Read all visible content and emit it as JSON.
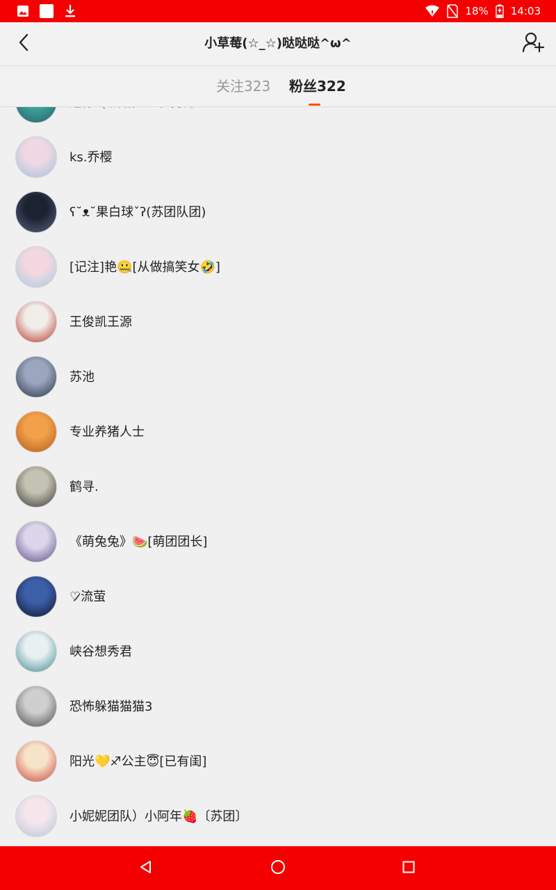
{
  "status_bar": {
    "battery": "18%",
    "time": "14:03",
    "icons": [
      "image-icon",
      "square-icon",
      "download-icon",
      "wifi-icon",
      "no-sim-icon",
      "battery-icon"
    ]
  },
  "header": {
    "title": "小草莓(☆_☆)哒哒哒^ω^",
    "back_icon": "chevron-left-icon",
    "action_icon": "add-user-icon"
  },
  "tabs": {
    "following_label": "关注323",
    "followers_label": "粉丝322",
    "active": "followers",
    "indicator_color": "#ff4c00"
  },
  "followers": [
    {
      "name": "迷你🍀酥糖<正在努力>",
      "avatar_colors": [
        "#3aa39a",
        "#2c5f6a"
      ]
    },
    {
      "name": "ks.乔樱",
      "avatar_colors": [
        "#f1d9e3",
        "#9fc2dc"
      ]
    },
    {
      "name": "ʕ˘ᴥ˘果白球ˇʔ(苏团队团)",
      "avatar_colors": [
        "#1d2233",
        "#5a6280"
      ]
    },
    {
      "name": "[记注]艳🤐[从做搞笑女🤣]",
      "avatar_colors": [
        "#f3d8e1",
        "#a8cce0"
      ]
    },
    {
      "name": "王俊凯王源",
      "avatar_colors": [
        "#f1eeea",
        "#b83228"
      ]
    },
    {
      "name": "苏池",
      "avatar_colors": [
        "#9aa7bf",
        "#2b3245"
      ]
    },
    {
      "name": "专业养猪人士",
      "avatar_colors": [
        "#f2a04a",
        "#b45a1c"
      ]
    },
    {
      "name": "鹤寻.",
      "avatar_colors": [
        "#c4c2b2",
        "#3b3a36"
      ]
    },
    {
      "name": "《萌兔兔》🍉[萌团团长]",
      "avatar_colors": [
        "#dcd6ea",
        "#5a4e88"
      ]
    },
    {
      "name": "♡̷流萤",
      "avatar_colors": [
        "#3c5fa8",
        "#0e1430"
      ]
    },
    {
      "name": "峡谷想秀君",
      "avatar_colors": [
        "#e8f0f2",
        "#3d8a93"
      ]
    },
    {
      "name": "恐怖躲猫猫猫3",
      "avatar_colors": [
        "#cfcfcf",
        "#4a4a4a"
      ]
    },
    {
      "name": "阳光💛♐公主😇[已有闺]",
      "avatar_colors": [
        "#f7e3c7",
        "#c8453b"
      ]
    },
    {
      "name": "小妮妮团队）小阿年🍓〔苏团〕",
      "avatar_colors": [
        "#f7e6ec",
        "#b9c6df"
      ]
    }
  ],
  "nav_bar": {
    "icons": [
      "back-triangle-icon",
      "home-circle-icon",
      "recents-square-icon"
    ],
    "color": "#f50000"
  }
}
